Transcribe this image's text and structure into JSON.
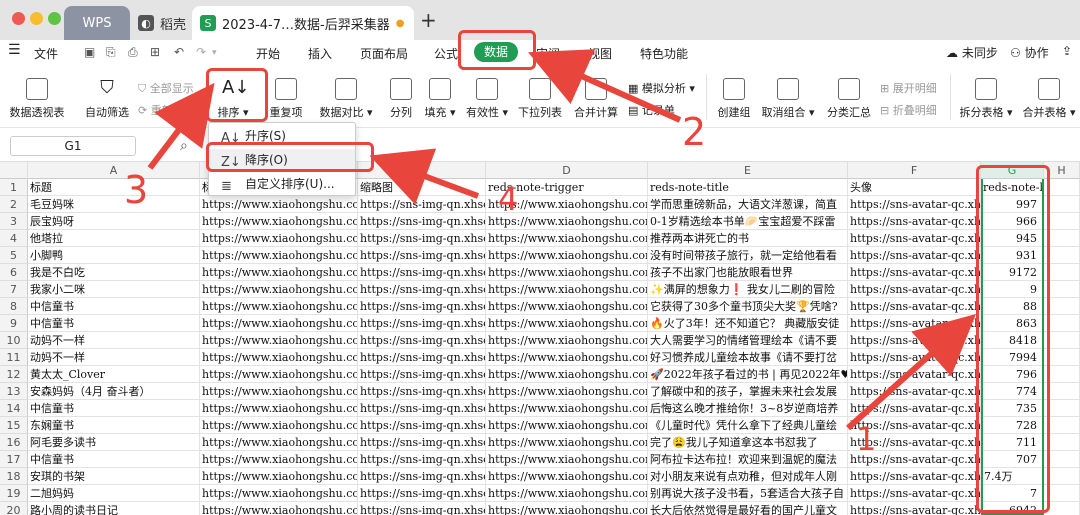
{
  "titlebar": {
    "tabs": [
      {
        "label": "WPS"
      },
      {
        "label": "稻壳"
      },
      {
        "label": "2023-4-7…数据-后羿采集器"
      }
    ],
    "new_tab": "+"
  },
  "menu": {
    "file": "文件",
    "items": [
      "开始",
      "插入",
      "页面布局",
      "公式",
      "数据",
      "审阅",
      "视图",
      "特色功能"
    ],
    "right": [
      "未同步",
      "协作",
      "分享"
    ]
  },
  "ribbon": {
    "pivot": "数据透视表",
    "autofilter": "自动筛选",
    "show_all": "全部显示",
    "reapply": "重新应用",
    "sort": "排序",
    "duplicates": "重复项",
    "compare": "数据对比",
    "split": "分列",
    "fill": "填充",
    "validity": "有效性",
    "dropdown_list": "下拉列表",
    "consolidate": "合并计算",
    "simulate": "模拟分析",
    "record": "记录单",
    "create_group": "创建组",
    "ungroup": "取消组合",
    "subtotal": "分类汇总",
    "expand": "展开明细",
    "collapse": "折叠明细",
    "split_table": "拆分表格",
    "merge_table": "合并表格"
  },
  "formula": {
    "cell_ref": "G1",
    "zoom_icon": "magnifier-icon"
  },
  "sort_menu": {
    "asc": "升序(S)",
    "desc": "降序(O)",
    "custom": "自定义排序(U)..."
  },
  "annotations": [
    "1",
    "2",
    "3",
    "4"
  ],
  "columns": [
    "A",
    "B",
    "C",
    "D",
    "E",
    "F",
    "G",
    "H"
  ],
  "header_row": {
    "A": "标题",
    "B": "标",
    "C": "缩略图",
    "D": "reds-note-trigger",
    "E": "reds-note-title",
    "F": "头像",
    "G": "reds-note-like-text"
  },
  "rows": [
    {
      "A": "毛豆妈咪",
      "E": "学而思重磅新品，大语文洋葱课，简直",
      "G": "997"
    },
    {
      "A": "辰宝妈呀",
      "E": "0-1岁精选绘本书单🥟宝宝超爱不踩雷",
      "G": "966"
    },
    {
      "A": "他塔拉",
      "E": "推荐两本讲死亡的书",
      "G": "945"
    },
    {
      "A": "小脚鸭",
      "E": "没有时间带孩子旅行，就一定给他看看",
      "G": "931"
    },
    {
      "A": "我是不白吃",
      "E": "孩子不出家门也能放眼看世界",
      "G": "9172"
    },
    {
      "A": "我家小二咪",
      "E": "✨满屏的想象力❗ 我女儿二刷的冒险",
      "G": "9"
    },
    {
      "A": "中信童书",
      "E": "它获得了30多个童书顶尖大奖🏆凭啥?",
      "G": "88"
    },
    {
      "A": "中信童书",
      "E": "🔥火了3年！还不知道它？ 典藏版安徒",
      "G": "863"
    },
    {
      "A": "动妈不一样",
      "E": "大人需要学习的情绪管理绘本《请不要",
      "G": "8418"
    },
    {
      "A": "动妈不一样",
      "E": "好习惯养成儿童绘本故事《请不要打岔",
      "G": "7994"
    },
    {
      "A": "黄太太_Clover",
      "E": "🚀2022年孩子看过的书 | 再见2022年♥",
      "G": "796"
    },
    {
      "A": "安森妈妈（4月 奋斗者）",
      "E": "了解碳中和的孩子，掌握未来社会发展",
      "G": "774"
    },
    {
      "A": "中信童书",
      "E": "后悔这么晚才推给你！3~8岁逆商培养",
      "G": "735"
    },
    {
      "A": "东娴童书",
      "E": "《儿童时代》凭什么拿下了经典儿童绘",
      "G": "728"
    },
    {
      "A": "阿毛要多读书",
      "E": "完了😩我儿子知道拿这本书怼我了",
      "G": "711"
    },
    {
      "A": "中信童书",
      "E": "阿布拉卡达布拉！欢迎来到温妮的魔法",
      "G": "707"
    },
    {
      "A": "安琪的书架",
      "E": "对小朋友来说有点劝稚，但对成年人刚",
      "G": "7.4万"
    },
    {
      "A": "二旭妈妈",
      "E": "别再说大孩子没书看，5套适合大孩子自",
      "G": "7"
    },
    {
      "A": "路小周的读书日记",
      "E": "长大后依然觉得是最好看的国产儿童文",
      "G": "6942"
    }
  ],
  "url_prefixes": {
    "B": "https://www.xiaohongshu.com/",
    "C": "https://sns-img-qn.xhscdn",
    "D": "https://www.xiaohongshu.com/d",
    "F": "https://sns-avatar-qc.xhsc"
  },
  "colors": {
    "accent": "#1f9d55",
    "annotation": "#e8453c"
  }
}
